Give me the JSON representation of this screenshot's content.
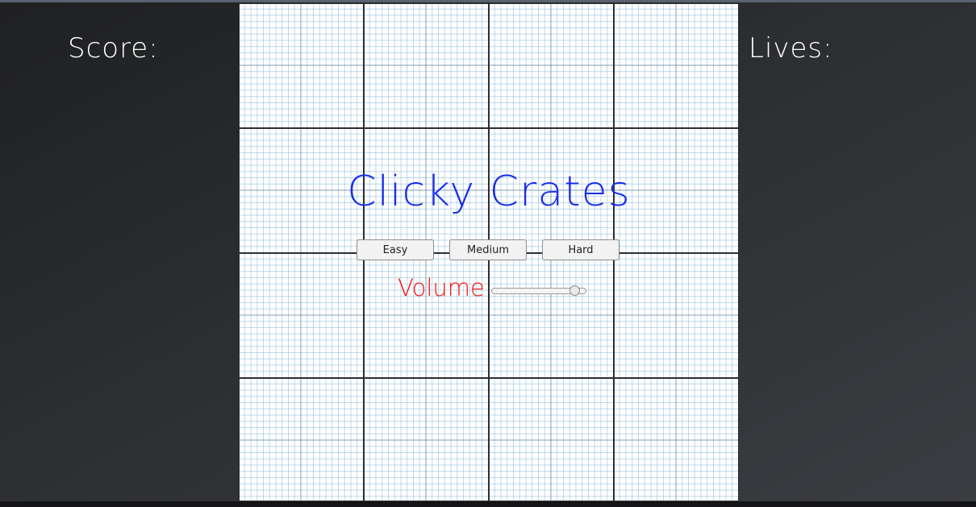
{
  "hud": {
    "score_label": "Score:",
    "lives_label": "Lives:"
  },
  "menu": {
    "title": "Clicky Crates",
    "difficulty_buttons": [
      {
        "label": "Easy"
      },
      {
        "label": "Medium"
      },
      {
        "label": "Hard"
      }
    ],
    "volume": {
      "label": "Volume",
      "value": 0.92
    }
  },
  "colors": {
    "title": "#1a2ee8",
    "volume_label": "#ff1111",
    "hud_text": "#ffffff"
  }
}
